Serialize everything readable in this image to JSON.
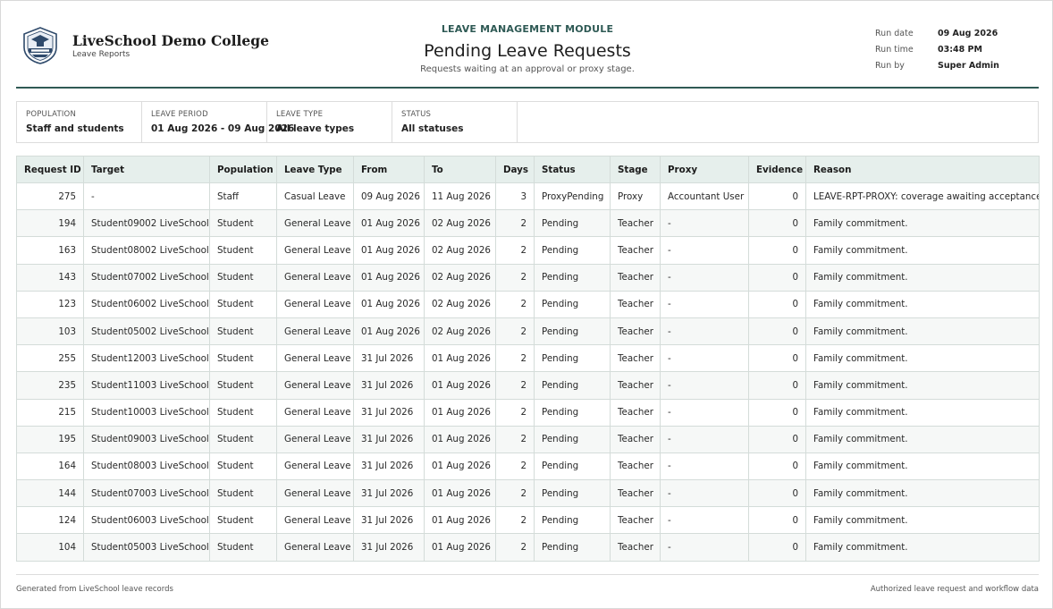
{
  "header": {
    "college_name": "LiveSchool Demo College",
    "college_sub": "Leave Reports",
    "module": "LEAVE MANAGEMENT MODULE",
    "title": "Pending Leave Requests",
    "subtitle": "Requests waiting at an approval or proxy stage.",
    "meta": [
      {
        "label": "Run date",
        "value": "09 Aug 2026"
      },
      {
        "label": "Run time",
        "value": "03:48 PM"
      },
      {
        "label": "Run by",
        "value": "Super Admin"
      }
    ]
  },
  "filters": [
    {
      "label": "POPULATION",
      "value": "Staff and students"
    },
    {
      "label": "LEAVE PERIOD",
      "value": "01 Aug 2026 - 09 Aug 2026"
    },
    {
      "label": "LEAVE TYPE",
      "value": "All leave types"
    },
    {
      "label": "STATUS",
      "value": "All statuses"
    }
  ],
  "table": {
    "columns": [
      "Request ID",
      "Target",
      "Population",
      "Leave Type",
      "From",
      "To",
      "Days",
      "Status",
      "Stage",
      "Proxy",
      "Evidence",
      "Reason"
    ],
    "rows": [
      [
        "275",
        "-",
        "Staff",
        "Casual Leave",
        "09 Aug 2026",
        "11 Aug 2026",
        "3",
        "ProxyPending",
        "Proxy",
        "Accountant User",
        "0",
        "LEAVE-RPT-PROXY: coverage awaiting acceptance"
      ],
      [
        "194",
        "Student09002 LiveSchool",
        "Student",
        "General Leave",
        "01 Aug 2026",
        "02 Aug 2026",
        "2",
        "Pending",
        "Teacher",
        "-",
        "0",
        "Family commitment."
      ],
      [
        "163",
        "Student08002 LiveSchool",
        "Student",
        "General Leave",
        "01 Aug 2026",
        "02 Aug 2026",
        "2",
        "Pending",
        "Teacher",
        "-",
        "0",
        "Family commitment."
      ],
      [
        "143",
        "Student07002 LiveSchool",
        "Student",
        "General Leave",
        "01 Aug 2026",
        "02 Aug 2026",
        "2",
        "Pending",
        "Teacher",
        "-",
        "0",
        "Family commitment."
      ],
      [
        "123",
        "Student06002 LiveSchool",
        "Student",
        "General Leave",
        "01 Aug 2026",
        "02 Aug 2026",
        "2",
        "Pending",
        "Teacher",
        "-",
        "0",
        "Family commitment."
      ],
      [
        "103",
        "Student05002 LiveSchool",
        "Student",
        "General Leave",
        "01 Aug 2026",
        "02 Aug 2026",
        "2",
        "Pending",
        "Teacher",
        "-",
        "0",
        "Family commitment."
      ],
      [
        "255",
        "Student12003 LiveSchool",
        "Student",
        "General Leave",
        "31 Jul 2026",
        "01 Aug 2026",
        "2",
        "Pending",
        "Teacher",
        "-",
        "0",
        "Family commitment."
      ],
      [
        "235",
        "Student11003 LiveSchool",
        "Student",
        "General Leave",
        "31 Jul 2026",
        "01 Aug 2026",
        "2",
        "Pending",
        "Teacher",
        "-",
        "0",
        "Family commitment."
      ],
      [
        "215",
        "Student10003 LiveSchool",
        "Student",
        "General Leave",
        "31 Jul 2026",
        "01 Aug 2026",
        "2",
        "Pending",
        "Teacher",
        "-",
        "0",
        "Family commitment."
      ],
      [
        "195",
        "Student09003 LiveSchool",
        "Student",
        "General Leave",
        "31 Jul 2026",
        "01 Aug 2026",
        "2",
        "Pending",
        "Teacher",
        "-",
        "0",
        "Family commitment."
      ],
      [
        "164",
        "Student08003 LiveSchool",
        "Student",
        "General Leave",
        "31 Jul 2026",
        "01 Aug 2026",
        "2",
        "Pending",
        "Teacher",
        "-",
        "0",
        "Family commitment."
      ],
      [
        "144",
        "Student07003 LiveSchool",
        "Student",
        "General Leave",
        "31 Jul 2026",
        "01 Aug 2026",
        "2",
        "Pending",
        "Teacher",
        "-",
        "0",
        "Family commitment."
      ],
      [
        "124",
        "Student06003 LiveSchool",
        "Student",
        "General Leave",
        "31 Jul 2026",
        "01 Aug 2026",
        "2",
        "Pending",
        "Teacher",
        "-",
        "0",
        "Family commitment."
      ],
      [
        "104",
        "Student05003 LiveSchool",
        "Student",
        "General Leave",
        "31 Jul 2026",
        "01 Aug 2026",
        "2",
        "Pending",
        "Teacher",
        "-",
        "0",
        "Family commitment."
      ]
    ]
  },
  "footer": {
    "left": "Generated from LiveSchool leave records",
    "right": "Authorized leave request and workflow data"
  },
  "colors": {
    "accent": "#2f5a55",
    "header_bg": "#e6efec"
  },
  "icons": {
    "logo": "college-crest-icon"
  }
}
